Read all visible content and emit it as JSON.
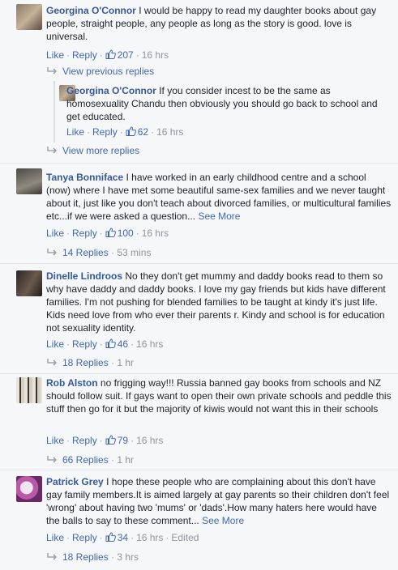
{
  "comments": [
    {
      "name": "Georgina O'Connor",
      "text": "I would be happy to read my daughter books about gay people, straight people, any people as long as the story is good. love is universal.",
      "like": "Like",
      "reply": "Reply",
      "likes": "207",
      "time": "16 hrs",
      "replies_link": "View previous replies"
    },
    {
      "name": "Georgina O'Connor",
      "text": "If you consider incest to be the same as homosexuality Chandu then obviously you should go back to school and get educated.",
      "like": "Like",
      "reply": "Reply",
      "likes": "62",
      "time": "16 hrs",
      "replies_link": "View more replies"
    },
    {
      "name": "Tanya Bonniface",
      "text": "I have worked in an early childhood centre and a school (now) where I have met some beautiful same-sex families and we never taught about it, just like you don't teach about divorced families, or multicultural families etc...if we were asked a question...",
      "see_more": "See More",
      "like": "Like",
      "reply": "Reply",
      "likes": "100",
      "time": "16 hrs",
      "replies_count": "14 Replies",
      "replies_time": "53 mins"
    },
    {
      "name": "Dinelle Lindroos",
      "text": "No they don't get mummy and daddy books read to them so why have daddy and daddy books. I love my gay friends but kids have different families. I'm not pushing for blended families to be taught at kindy it's just life. Kids need love from who ever their parents r. Kindy and school is for education not sexuality identity.",
      "like": "Like",
      "reply": "Reply",
      "likes": "46",
      "time": "16 hrs",
      "replies_count": "18 Replies",
      "replies_time": "1 hr"
    },
    {
      "name": "Rob Alston",
      "text": "no frigging way!!! Russia banned gay books from schools and NZ should follow suit. If gays want to open their own private schools and peddle this stuff then go for it but the majority of kiwis would not want this in their schools",
      "like": "Like",
      "reply": "Reply",
      "likes": "79",
      "time": "16 hrs",
      "replies_count": "66 Replies",
      "replies_time": "1 hr"
    },
    {
      "name": "Patrick Grey",
      "text": "I hope these people who are complaining about this don't have gay family members.It is aimed largely at gay parents so their children don't feel 'wrong' about having two 'mums' or 'dads'.How many haters here would have the balls to say to these comment...",
      "see_more": "See More",
      "like": "Like",
      "reply": "Reply",
      "likes": "34",
      "time": "16 hrs",
      "edited": "Edited",
      "replies_count": "18 Replies",
      "replies_time": "3 hrs"
    }
  ],
  "colors": {
    "link": "#365899",
    "action": "#4267b2",
    "meta": "#90949c",
    "text": "#1d2129",
    "bg": "#f6f7f9"
  }
}
